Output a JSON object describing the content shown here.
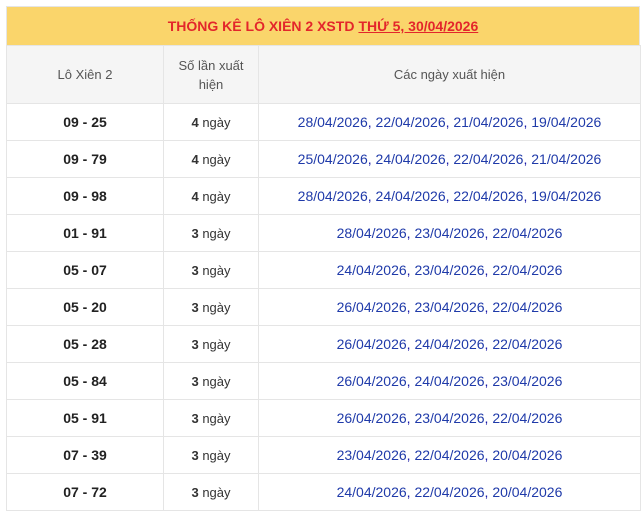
{
  "title": {
    "text": "THỐNG KÊ LÔ XIÊN 2 XSTD",
    "date_link": "THỨ 5, 30/04/2026"
  },
  "headers": {
    "col1": "Lô Xiên 2",
    "col2": "Số lần xuất hiện",
    "col3": "Các ngày xuất hiện"
  },
  "unit": "ngày",
  "rows": [
    {
      "pair": "09 - 25",
      "count": "4",
      "dates": [
        "28/04/2026",
        "22/04/2026",
        "21/04/2026",
        "19/04/2026"
      ]
    },
    {
      "pair": "09 - 79",
      "count": "4",
      "dates": [
        "25/04/2026",
        "24/04/2026",
        "22/04/2026",
        "21/04/2026"
      ]
    },
    {
      "pair": "09 - 98",
      "count": "4",
      "dates": [
        "28/04/2026",
        "24/04/2026",
        "22/04/2026",
        "19/04/2026"
      ]
    },
    {
      "pair": "01 - 91",
      "count": "3",
      "dates": [
        "28/04/2026",
        "23/04/2026",
        "22/04/2026"
      ]
    },
    {
      "pair": "05 - 07",
      "count": "3",
      "dates": [
        "24/04/2026",
        "23/04/2026",
        "22/04/2026"
      ]
    },
    {
      "pair": "05 - 20",
      "count": "3",
      "dates": [
        "26/04/2026",
        "23/04/2026",
        "22/04/2026"
      ]
    },
    {
      "pair": "05 - 28",
      "count": "3",
      "dates": [
        "26/04/2026",
        "24/04/2026",
        "22/04/2026"
      ]
    },
    {
      "pair": "05 - 84",
      "count": "3",
      "dates": [
        "26/04/2026",
        "24/04/2026",
        "23/04/2026"
      ]
    },
    {
      "pair": "05 - 91",
      "count": "3",
      "dates": [
        "26/04/2026",
        "23/04/2026",
        "22/04/2026"
      ]
    },
    {
      "pair": "07 - 39",
      "count": "3",
      "dates": [
        "23/04/2026",
        "22/04/2026",
        "20/04/2026"
      ]
    },
    {
      "pair": "07 - 72",
      "count": "3",
      "dates": [
        "24/04/2026",
        "22/04/2026",
        "20/04/2026"
      ]
    }
  ],
  "colors": {
    "title_bg": "#fad56b",
    "title_text": "#e3262b",
    "header_bg": "#f5f5f5",
    "date_link": "#1f3aa9"
  }
}
